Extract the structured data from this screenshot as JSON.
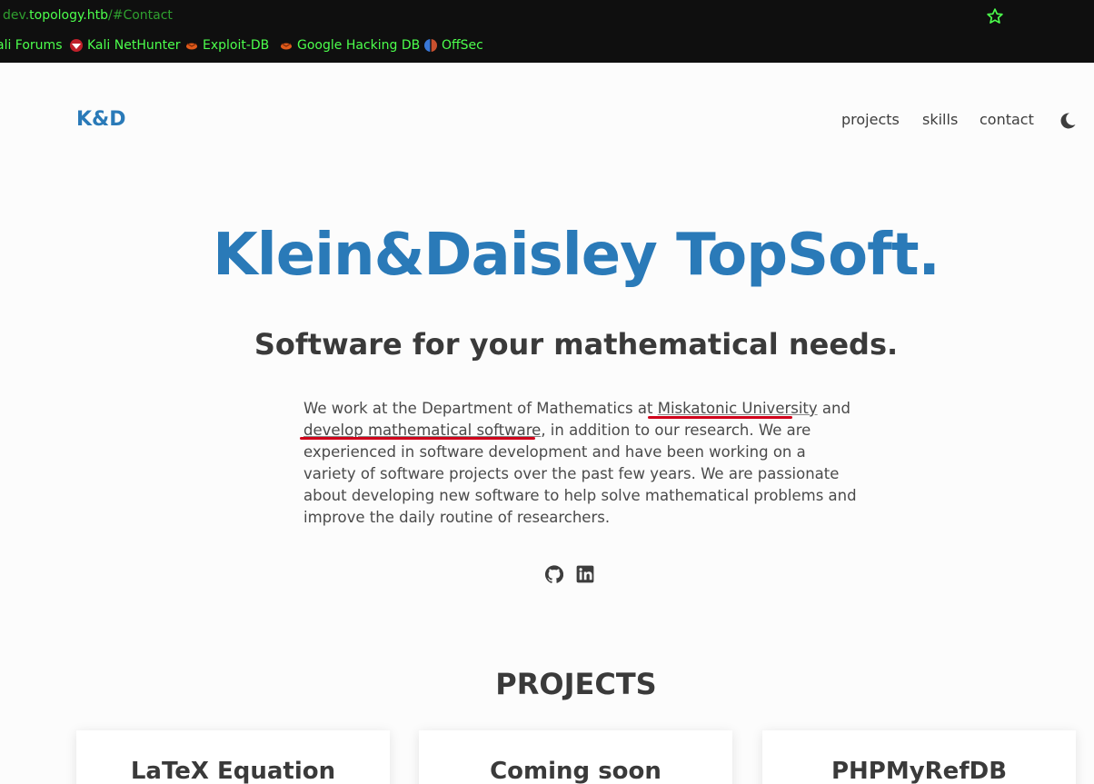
{
  "browser": {
    "url_prefix": "dev.",
    "url_host": "topology.htb",
    "url_path": "/#Contact",
    "bookmarks": [
      {
        "label": "ali Forums"
      },
      {
        "label": "Kali NetHunter"
      },
      {
        "label": "Exploit-DB"
      },
      {
        "label": "Google Hacking DB"
      },
      {
        "label": "OffSec"
      }
    ]
  },
  "header": {
    "logo": "K&D",
    "nav": [
      "projects",
      "skills",
      "contact"
    ]
  },
  "hero": {
    "title": "Klein&Daisley TopSoft.",
    "subtitle": "Software for your mathematical needs.",
    "intro_1": "We work at the Department of Mathematics at ",
    "intro_link1": "Miskatonic University",
    "intro_2": " and ",
    "intro_link2": "develop mathematical software",
    "intro_3": ", in addition to our research. We are experienced in software development and have been working on a variety of software projects over the past few years. We are passionate about developing new software to help solve mathematical problems and improve the daily routine of researchers."
  },
  "social": [
    "github-icon",
    "linkedin-icon"
  ],
  "projects": {
    "title": "PROJECTS",
    "cards": [
      "LaTeX Equation",
      "Coming soon",
      "PHPMyRefDB"
    ]
  },
  "colors": {
    "brand": "#2a7ab8",
    "text": "#3a3a3a",
    "highlight": "#d0021b",
    "chrome_text": "#4cff4c"
  }
}
